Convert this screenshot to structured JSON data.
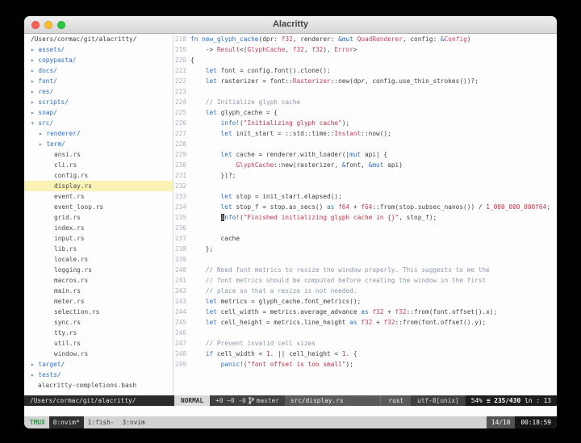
{
  "window": {
    "title": "Alacritty"
  },
  "sidebar": {
    "root_path": "/Users/cormac/git/alacritty/",
    "statusline": "/Users/cormac/git/alacritty/",
    "items": [
      {
        "label": "assets/",
        "type": "dir",
        "arrow": "▸",
        "indent": 0
      },
      {
        "label": "copypasta/",
        "type": "dir",
        "arrow": "▸",
        "indent": 0
      },
      {
        "label": "docs/",
        "type": "dir",
        "arrow": "▸",
        "indent": 0
      },
      {
        "label": "font/",
        "type": "dir",
        "arrow": "▸",
        "indent": 0
      },
      {
        "label": "res/",
        "type": "dir",
        "arrow": "▸",
        "indent": 0
      },
      {
        "label": "scripts/",
        "type": "dir",
        "arrow": "▸",
        "indent": 0
      },
      {
        "label": "snap/",
        "type": "dir",
        "arrow": "▸",
        "indent": 0
      },
      {
        "label": "src/",
        "type": "dir",
        "arrow": "▾",
        "indent": 0
      },
      {
        "label": "renderer/",
        "type": "dir",
        "arrow": "▸",
        "indent": 1
      },
      {
        "label": "term/",
        "type": "dir",
        "arrow": "▸",
        "indent": 1
      },
      {
        "label": "ansi.rs",
        "type": "file",
        "indent": 2
      },
      {
        "label": "cli.rs",
        "type": "file",
        "indent": 2
      },
      {
        "label": "config.rs",
        "type": "file",
        "indent": 2
      },
      {
        "label": "display.rs",
        "type": "file",
        "indent": 2,
        "selected": true
      },
      {
        "label": "event.rs",
        "type": "file",
        "indent": 2
      },
      {
        "label": "event_loop.rs",
        "type": "file",
        "indent": 2
      },
      {
        "label": "grid.rs",
        "type": "file",
        "indent": 2
      },
      {
        "label": "index.rs",
        "type": "file",
        "indent": 2
      },
      {
        "label": "input.rs",
        "type": "file",
        "indent": 2
      },
      {
        "label": "lib.rs",
        "type": "file",
        "indent": 2
      },
      {
        "label": "locale.rs",
        "type": "file",
        "indent": 2
      },
      {
        "label": "logging.rs",
        "type": "file",
        "indent": 2
      },
      {
        "label": "macros.rs",
        "type": "file",
        "indent": 2
      },
      {
        "label": "main.rs",
        "type": "file",
        "indent": 2
      },
      {
        "label": "meter.rs",
        "type": "file",
        "indent": 2
      },
      {
        "label": "selection.rs",
        "type": "file",
        "indent": 2
      },
      {
        "label": "sync.rs",
        "type": "file",
        "indent": 2
      },
      {
        "label": "tty.rs",
        "type": "file",
        "indent": 2
      },
      {
        "label": "util.rs",
        "type": "file",
        "indent": 2
      },
      {
        "label": "window.rs",
        "type": "file",
        "indent": 2
      },
      {
        "label": "target/",
        "type": "dir",
        "arrow": "▸",
        "indent": 0
      },
      {
        "label": "tests/",
        "type": "dir",
        "arrow": "▸",
        "indent": 0
      },
      {
        "label": "alacritty-completions.bash",
        "type": "file",
        "indent": 0
      }
    ]
  },
  "editor": {
    "lines": [
      {
        "n": 218,
        "t": [
          [
            "k",
            "fn "
          ],
          [
            "f",
            "new_glyph_cache"
          ],
          [
            "d",
            "(dpr: "
          ],
          [
            "t",
            "f32"
          ],
          [
            "d",
            ", renderer: "
          ],
          [
            "k",
            "&mut "
          ],
          [
            "t",
            "QuadRenderer"
          ],
          [
            "d",
            ", config: "
          ],
          [
            "k",
            "&"
          ],
          [
            "t",
            "Config"
          ],
          [
            "d",
            ")"
          ]
        ]
      },
      {
        "n": 219,
        "t": [
          [
            "d",
            "    -> "
          ],
          [
            "t",
            "Result"
          ],
          [
            "d",
            "<("
          ],
          [
            "t",
            "GlyphCache"
          ],
          [
            "d",
            ", "
          ],
          [
            "t",
            "f32"
          ],
          [
            "d",
            ", "
          ],
          [
            "t",
            "f32"
          ],
          [
            "d",
            "), "
          ],
          [
            "t",
            "Error"
          ],
          [
            "d",
            ">"
          ]
        ]
      },
      {
        "n": 220,
        "t": [
          [
            "d",
            "{"
          ]
        ]
      },
      {
        "n": 221,
        "t": [
          [
            "d",
            "    "
          ],
          [
            "k",
            "let "
          ],
          [
            "d",
            "font = config.font().clone();"
          ]
        ]
      },
      {
        "n": 222,
        "t": [
          [
            "d",
            "    "
          ],
          [
            "k",
            "let "
          ],
          [
            "d",
            "rasterizer = font::"
          ],
          [
            "t",
            "Rasterizer"
          ],
          [
            "d",
            "::new(dpr, config.use_thin_strokes())?;"
          ]
        ]
      },
      {
        "n": 223,
        "t": []
      },
      {
        "n": 224,
        "t": [
          [
            "c",
            "    // Initialize glyph cache"
          ]
        ]
      },
      {
        "n": 225,
        "t": [
          [
            "d",
            "    "
          ],
          [
            "k",
            "let "
          ],
          [
            "d",
            "glyph_cache = {"
          ]
        ]
      },
      {
        "n": 226,
        "t": [
          [
            "d",
            "        "
          ],
          [
            "m",
            "info!"
          ],
          [
            "d",
            "("
          ],
          [
            "s",
            "\"Initializing glyph cache\""
          ],
          [
            "d",
            ");"
          ]
        ]
      },
      {
        "n": 227,
        "t": [
          [
            "d",
            "        "
          ],
          [
            "k",
            "let "
          ],
          [
            "d",
            "init_start = ::std::time::"
          ],
          [
            "t",
            "Instant"
          ],
          [
            "d",
            "::now();"
          ]
        ]
      },
      {
        "n": 228,
        "t": []
      },
      {
        "n": 229,
        "t": [
          [
            "d",
            "        "
          ],
          [
            "k",
            "let "
          ],
          [
            "d",
            "cache = renderer.with_loader(|"
          ],
          [
            "k",
            "mut"
          ],
          [
            "d",
            " api| {"
          ]
        ]
      },
      {
        "n": 230,
        "t": [
          [
            "d",
            "            "
          ],
          [
            "t",
            "GlyphCache"
          ],
          [
            "d",
            "::new(rasterizer, "
          ],
          [
            "k",
            "&"
          ],
          [
            "d",
            "font, "
          ],
          [
            "k",
            "&mut"
          ],
          [
            "d",
            " api)"
          ]
        ]
      },
      {
        "n": 231,
        "t": [
          [
            "d",
            "        })?;"
          ]
        ]
      },
      {
        "n": 232,
        "t": []
      },
      {
        "n": 233,
        "t": [
          [
            "d",
            "        "
          ],
          [
            "k",
            "let "
          ],
          [
            "d",
            "stop = init_start.elapsed();"
          ]
        ]
      },
      {
        "n": 234,
        "t": [
          [
            "d",
            "        "
          ],
          [
            "k",
            "let "
          ],
          [
            "d",
            "stop_f = stop.as_secs() "
          ],
          [
            "k",
            "as "
          ],
          [
            "t",
            "f64"
          ],
          [
            "d",
            " + "
          ],
          [
            "t",
            "f64"
          ],
          [
            "d",
            "::from(stop.subsec_nanos()) / "
          ],
          [
            "n",
            "1_000_000_000f64"
          ],
          [
            "d",
            ";"
          ]
        ]
      },
      {
        "n": 235,
        "t": [
          [
            "d",
            "        "
          ],
          [
            "cur",
            "i"
          ],
          [
            "m",
            "nfo!"
          ],
          [
            "d",
            "("
          ],
          [
            "s",
            "\"Finished initializing glyph cache in {}\""
          ],
          [
            "d",
            ", stop_f);"
          ]
        ]
      },
      {
        "n": 236,
        "t": []
      },
      {
        "n": 237,
        "t": [
          [
            "d",
            "        cache"
          ]
        ]
      },
      {
        "n": 238,
        "t": [
          [
            "d",
            "    };"
          ]
        ]
      },
      {
        "n": 239,
        "t": []
      },
      {
        "n": 240,
        "t": [
          [
            "c",
            "    // Need font metrics to resize the window properly. This suggests to me the"
          ]
        ]
      },
      {
        "n": 241,
        "t": [
          [
            "c",
            "    // font metrics should be computed before creating the window in the first"
          ]
        ]
      },
      {
        "n": 242,
        "t": [
          [
            "c",
            "    // place so that a resize is not needed."
          ]
        ]
      },
      {
        "n": 243,
        "t": [
          [
            "d",
            "    "
          ],
          [
            "k",
            "let "
          ],
          [
            "d",
            "metrics = glyph_cache.font_metrics();"
          ]
        ]
      },
      {
        "n": 244,
        "t": [
          [
            "d",
            "    "
          ],
          [
            "k",
            "let "
          ],
          [
            "d",
            "cell_width = metrics.average_advance "
          ],
          [
            "k",
            "as "
          ],
          [
            "t",
            "f32"
          ],
          [
            "d",
            " + "
          ],
          [
            "t",
            "f32"
          ],
          [
            "d",
            "::from(font.offset().x);"
          ]
        ]
      },
      {
        "n": 245,
        "t": [
          [
            "d",
            "    "
          ],
          [
            "k",
            "let "
          ],
          [
            "d",
            "cell_height = metrics.line_height "
          ],
          [
            "k",
            "as "
          ],
          [
            "t",
            "f32"
          ],
          [
            "d",
            " + "
          ],
          [
            "t",
            "f32"
          ],
          [
            "d",
            "::from(font.offset().y);"
          ]
        ]
      },
      {
        "n": 246,
        "t": []
      },
      {
        "n": 247,
        "t": [
          [
            "c",
            "    // Prevent invalid cell sizes"
          ]
        ]
      },
      {
        "n": 248,
        "t": [
          [
            "d",
            "    "
          ],
          [
            "k",
            "if "
          ],
          [
            "d",
            "cell_width < "
          ],
          [
            "n",
            "1."
          ],
          [
            "d",
            " || cell_height < "
          ],
          [
            "n",
            "1."
          ],
          [
            "d",
            " {"
          ]
        ]
      },
      {
        "n": 249,
        "t": [
          [
            "d",
            "        "
          ],
          [
            "m",
            "panic!"
          ],
          [
            "d",
            "("
          ],
          [
            "s",
            "\"font offset is too small\""
          ],
          [
            "d",
            ");"
          ]
        ]
      }
    ]
  },
  "statusline": {
    "mode": "NORMAL",
    "git_hunks": "+0 ~0 -0",
    "branch": "master",
    "file": "src/display.rs",
    "filetype": "rust",
    "encoding": "utf-8[unix]",
    "percent": "54%",
    "linenr": "≡ 235/430",
    "column": "ln : 13"
  },
  "tmux": {
    "session": "TMUX",
    "windows": [
      {
        "label": "0:nvim*",
        "active": true
      },
      {
        "label": "1:fish-",
        "active": false
      },
      {
        "label": "3:nvim",
        "active": false
      }
    ],
    "date": "14/10",
    "time": "00:18:59"
  },
  "colors": {
    "bg": "#fdfdfd",
    "fg": "#3c3f45",
    "keyword": "#2b6fc2",
    "type": "#c9405c",
    "string": "#c22f46",
    "number": "#c22f46",
    "comment": "#8a98ab",
    "macro": "#2b6fc2",
    "func": "#2b6fc2",
    "linenr": "#aab1c2",
    "dirc": "#2b6fc2",
    "filec": "#45484e",
    "arrow": "#5d86c0",
    "selBg": "#fbf3b5",
    "cursorBg": "#2c2c2c",
    "cursorFg": "#ffffff",
    "red": "#ff5f57",
    "yellow": "#febc2e",
    "green": "#28c840",
    "titleFg": "#454545",
    "nerdBg": "#2a2a2a",
    "nerdFg": "#e2e2e2",
    "modeBg": "#dadada",
    "modeFg": "#2e2e2e",
    "gitBg": "#404040",
    "gitFg": "#dcdcdc",
    "fileBg": "#5a5a5a",
    "fileFg": "#f2f2f2",
    "posBg": "#1d1d1d",
    "posFg": "#ffffff",
    "tmuxBg": "#d2d2d2",
    "tmuxFg": "#383838",
    "session": "#2f9647",
    "winActiveBg": "#2e2e2e",
    "winActiveFg": "#e6efe6",
    "dateBg": "#535353",
    "timeBg": "#161616"
  }
}
